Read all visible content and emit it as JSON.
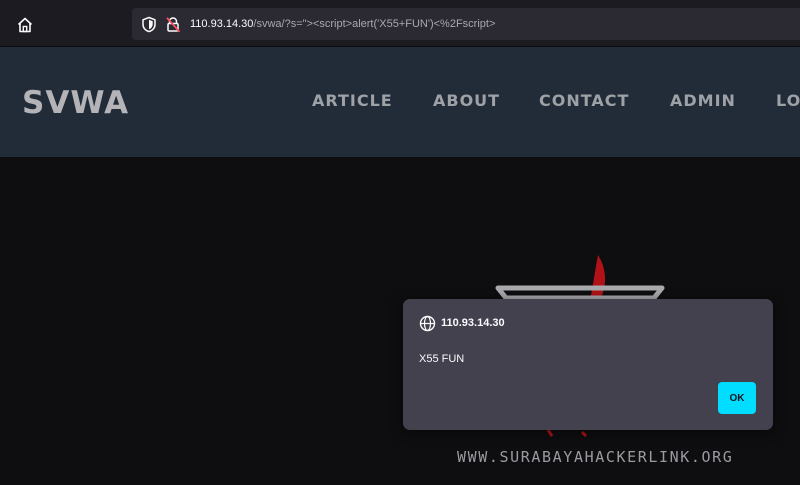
{
  "browser": {
    "url_host": "110.93.14.30",
    "url_path": "/svwa/?s=\"><script>alert('X55+FUN')<%2Fscript>"
  },
  "site": {
    "brand": "SVWA",
    "nav": [
      "ARTICLE",
      "ABOUT",
      "CONTACT",
      "ADMIN",
      "LO"
    ],
    "footer_url": "WWW.SURABAYAHACKERLINK.ORG"
  },
  "dialog": {
    "origin": "110.93.14.30",
    "message": "X55 FUN",
    "ok_label": "OK"
  },
  "colors": {
    "accent": "#00ddff",
    "logo_red": "#b01217"
  }
}
